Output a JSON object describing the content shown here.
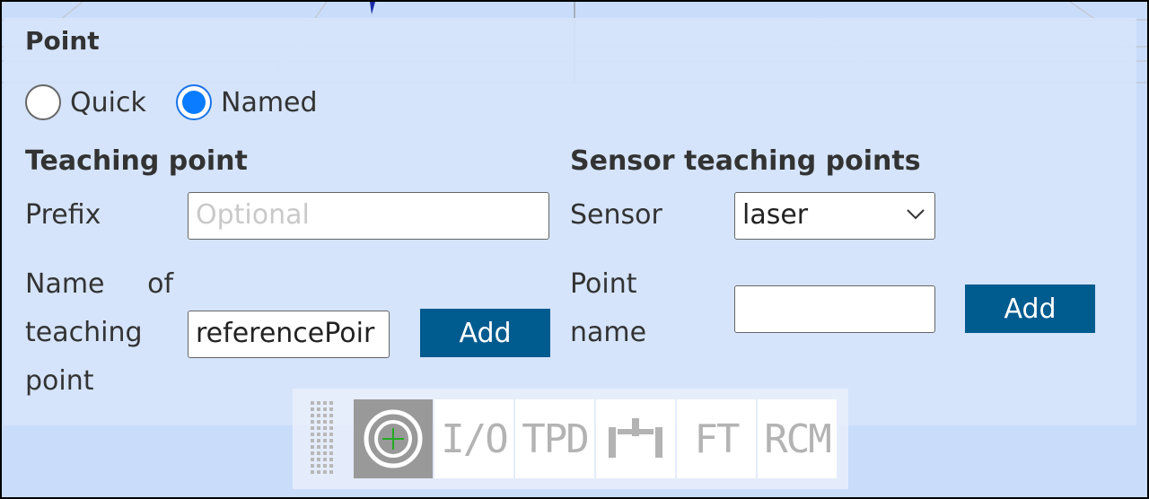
{
  "panel": {
    "title": "Point"
  },
  "mode": {
    "options": [
      {
        "label": "Quick",
        "checked": false
      },
      {
        "label": "Named",
        "checked": true
      }
    ]
  },
  "teaching": {
    "title": "Teaching point",
    "prefix_label": "Prefix",
    "prefix_placeholder": "Optional",
    "name_label_lines": [
      "Name     of",
      "teaching",
      "point"
    ],
    "name_value": "referencePoir",
    "add_label": "Add"
  },
  "sensor": {
    "title": "Sensor teaching points",
    "sensor_label": "Sensor",
    "sensor_value": "laser",
    "point_label_lines": [
      "Point",
      "name"
    ],
    "point_value": "",
    "add_label": "Add"
  },
  "toolbar": {
    "buttons": [
      {
        "name": "point-target",
        "label": "",
        "active": true
      },
      {
        "name": "io",
        "label": "I/O",
        "active": false
      },
      {
        "name": "tpd",
        "label": "TPD",
        "active": false
      },
      {
        "name": "tool",
        "label": "",
        "active": false
      },
      {
        "name": "ft",
        "label": "FT",
        "active": false
      },
      {
        "name": "rcm",
        "label": "RCM",
        "active": false
      }
    ]
  },
  "colors": {
    "accent": "#005b8f",
    "radio_selected": "#0a7cff",
    "panel_bg": "#d6e4fb",
    "target_green": "#22aa22"
  }
}
